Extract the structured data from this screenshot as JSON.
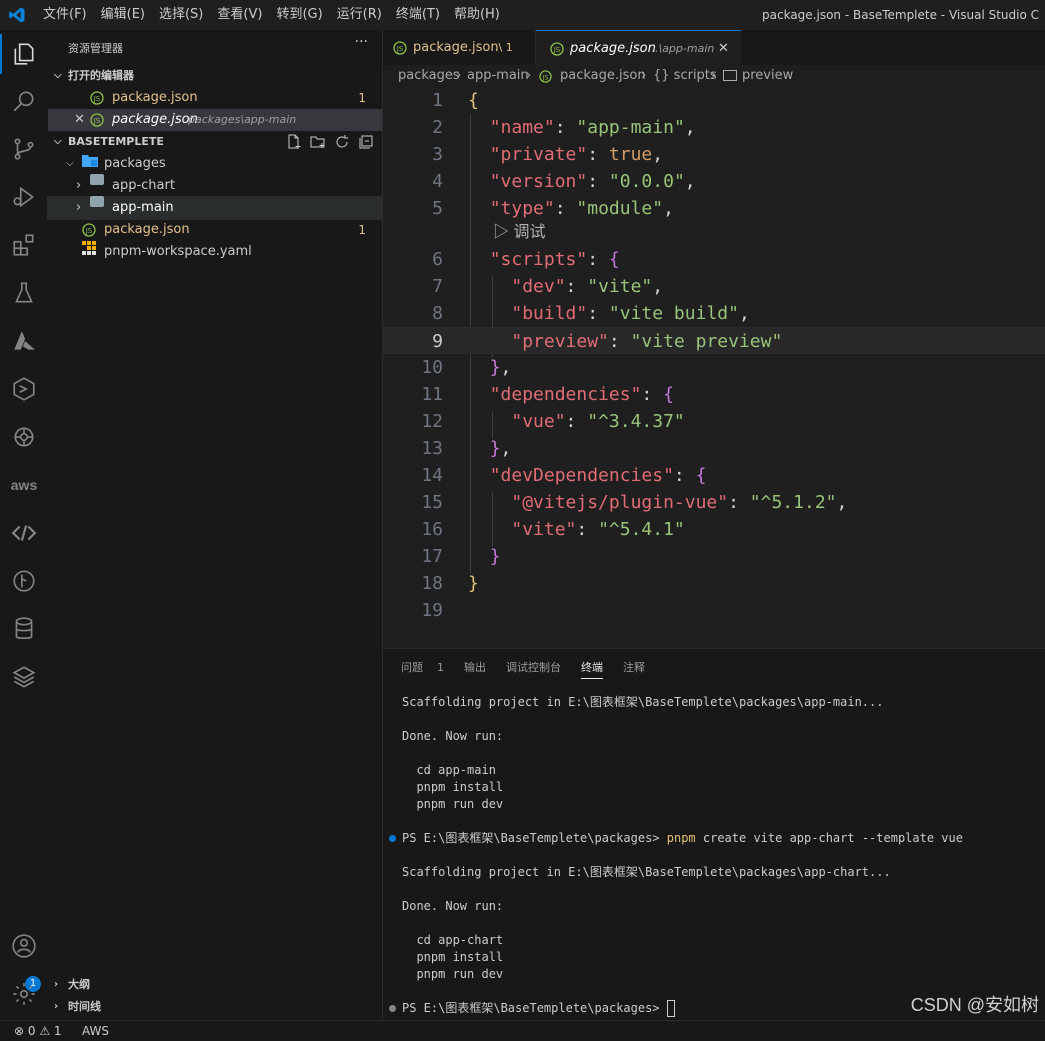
{
  "window": {
    "title": "package.json - BaseTemplete - Visual Studio C",
    "menu": [
      "文件(F)",
      "编辑(E)",
      "选择(S)",
      "查看(V)",
      "转到(G)",
      "运行(R)",
      "终端(T)",
      "帮助(H)"
    ]
  },
  "activity_bar": {
    "items": [
      "explorer-icon",
      "search-icon",
      "source-control-icon",
      "run-debug-icon",
      "extensions-icon",
      "testing-icon",
      "azure-icon",
      "remote-explorer-icon",
      "openai-icon",
      "aws-icon",
      "api-icon",
      "git-graph-icon",
      "database-icon",
      "layers-icon"
    ],
    "aws_label": "aws",
    "accounts_badge": "1"
  },
  "sidebar": {
    "title": "资源管理器",
    "more": "···",
    "open_editors": {
      "label": "打开的编辑器",
      "items": [
        {
          "name": "package.json",
          "count": "1"
        },
        {
          "name": "package.json",
          "path": "packages\\app-main"
        }
      ]
    },
    "workspace": {
      "label": "BASETEMPLETE",
      "tree": [
        {
          "name": "packages"
        },
        {
          "name": "app-chart"
        },
        {
          "name": "app-main"
        },
        {
          "name": "package.json",
          "count": "1"
        },
        {
          "name": "pnpm-workspace.yaml"
        }
      ]
    },
    "outline_label": "大纲",
    "timeline_label": "时间线"
  },
  "tabs": [
    {
      "name": "package.json",
      "path": ".\\ 1"
    },
    {
      "name": "package.json",
      "path": "...\\app-main"
    }
  ],
  "breadcrumb": [
    "packages",
    "app-main",
    "package.json",
    "{} scripts",
    "preview"
  ],
  "editor": {
    "current_line": 9,
    "codelens": "▷ 调试",
    "line_numbers": [
      "1",
      "2",
      "3",
      "4",
      "5",
      "6",
      "7",
      "8",
      "9",
      "10",
      "11",
      "12",
      "13",
      "14",
      "15",
      "16",
      "17",
      "18",
      "19"
    ]
  },
  "panel": {
    "tabs": [
      "问题",
      "输出",
      "调试控制台",
      "终端",
      "注释"
    ],
    "problems_count": "1",
    "terminal": {
      "l1": "Scaffolding project in E:\\图表框架\\BaseTemplete\\packages\\app-main...",
      "l2": "Done. Now run:",
      "l3": "  cd app-main",
      "l4": "  pnpm install",
      "l5": "  pnpm run dev",
      "prompt1": "PS E:\\图表框架\\BaseTemplete\\packages> ",
      "cmd": "pnpm",
      "cmd_args": " create vite app-chart --template vue",
      "l6": "Scaffolding project in E:\\图表框架\\BaseTemplete\\packages\\app-chart...",
      "l7": "Done. Now run:",
      "l8": "  cd app-chart",
      "l9": "  pnpm install",
      "l10": "  pnpm run dev",
      "prompt2": "PS E:\\图表框架\\BaseTemplete\\packages> "
    }
  },
  "status": {
    "problems": "⊗ 0 ⚠ 1",
    "aws": "AWS"
  },
  "watermark": "CSDN @安如树"
}
